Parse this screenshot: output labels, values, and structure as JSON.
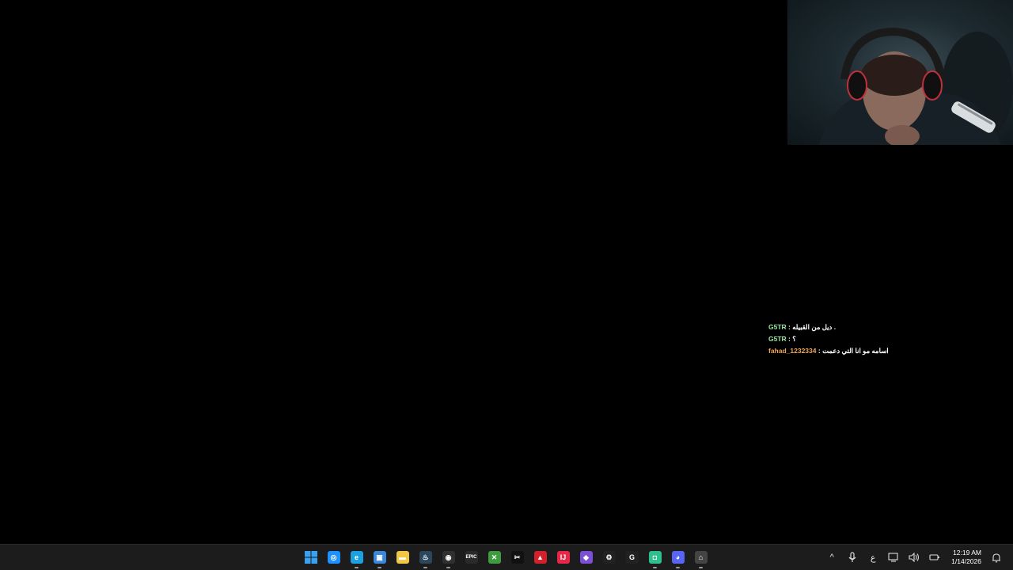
{
  "webcam": {
    "label": "streamer-webcam"
  },
  "chat": {
    "messages": [
      {
        "user": "G5TR",
        "separator": " : ",
        "text": "ديل من القبيله .",
        "color": "#9be6a0"
      },
      {
        "user": "G5TR",
        "separator": " : ",
        "text": "؟",
        "color": "#9be6a0"
      },
      {
        "user": "fahad_1232334",
        "separator": " : ",
        "text": "اسامه مو انا التي دعمت",
        "color": "#f0a55a"
      }
    ]
  },
  "taskbar": {
    "apps": [
      {
        "name": "start-icon",
        "glyph": "",
        "color": "#3aa0f0",
        "running": false
      },
      {
        "name": "safari-icon",
        "glyph": "◎",
        "color": "#1e90ff",
        "running": false
      },
      {
        "name": "edge-icon",
        "glyph": "e",
        "color": "#1ba1e2",
        "running": true
      },
      {
        "name": "photos-icon",
        "glyph": "▣",
        "color": "#3b87d8",
        "running": true
      },
      {
        "name": "file-explorer-icon",
        "glyph": "▬",
        "color": "#f2c744",
        "running": false
      },
      {
        "name": "steam-icon",
        "glyph": "♨",
        "color": "#2a475e",
        "running": true
      },
      {
        "name": "obs-icon",
        "glyph": "◉",
        "color": "#303030",
        "running": true
      },
      {
        "name": "epic-games-icon",
        "glyph": "EPIC",
        "color": "#2a2a2a",
        "running": false
      },
      {
        "name": "minecraft-icon",
        "glyph": "✕",
        "color": "#3f9b3f",
        "running": false
      },
      {
        "name": "capcut-icon",
        "glyph": "✂",
        "color": "#111111",
        "running": false
      },
      {
        "name": "amd-icon",
        "glyph": "▲",
        "color": "#d4202b",
        "running": false
      },
      {
        "name": "jetbrains-icon",
        "glyph": "IJ",
        "color": "#e8264a",
        "running": false
      },
      {
        "name": "microsoft365-icon",
        "glyph": "◆",
        "color": "#7b4fd6",
        "running": false
      },
      {
        "name": "steelseries-icon",
        "glyph": "⚙",
        "color": "#222222",
        "running": false
      },
      {
        "name": "logitech-icon",
        "glyph": "G",
        "color": "#222222",
        "running": false
      },
      {
        "name": "chatgpt-icon",
        "glyph": "◘",
        "color": "#2fbf8f",
        "running": true
      },
      {
        "name": "discord-icon",
        "glyph": "◕",
        "color": "#5865f2",
        "running": true
      },
      {
        "name": "misc-app-icon",
        "glyph": "⌂",
        "color": "#444444",
        "running": true
      }
    ],
    "tray": {
      "chevron": "^",
      "language": "ع",
      "time": "12:19 AM",
      "date": "1/14/2026"
    }
  }
}
